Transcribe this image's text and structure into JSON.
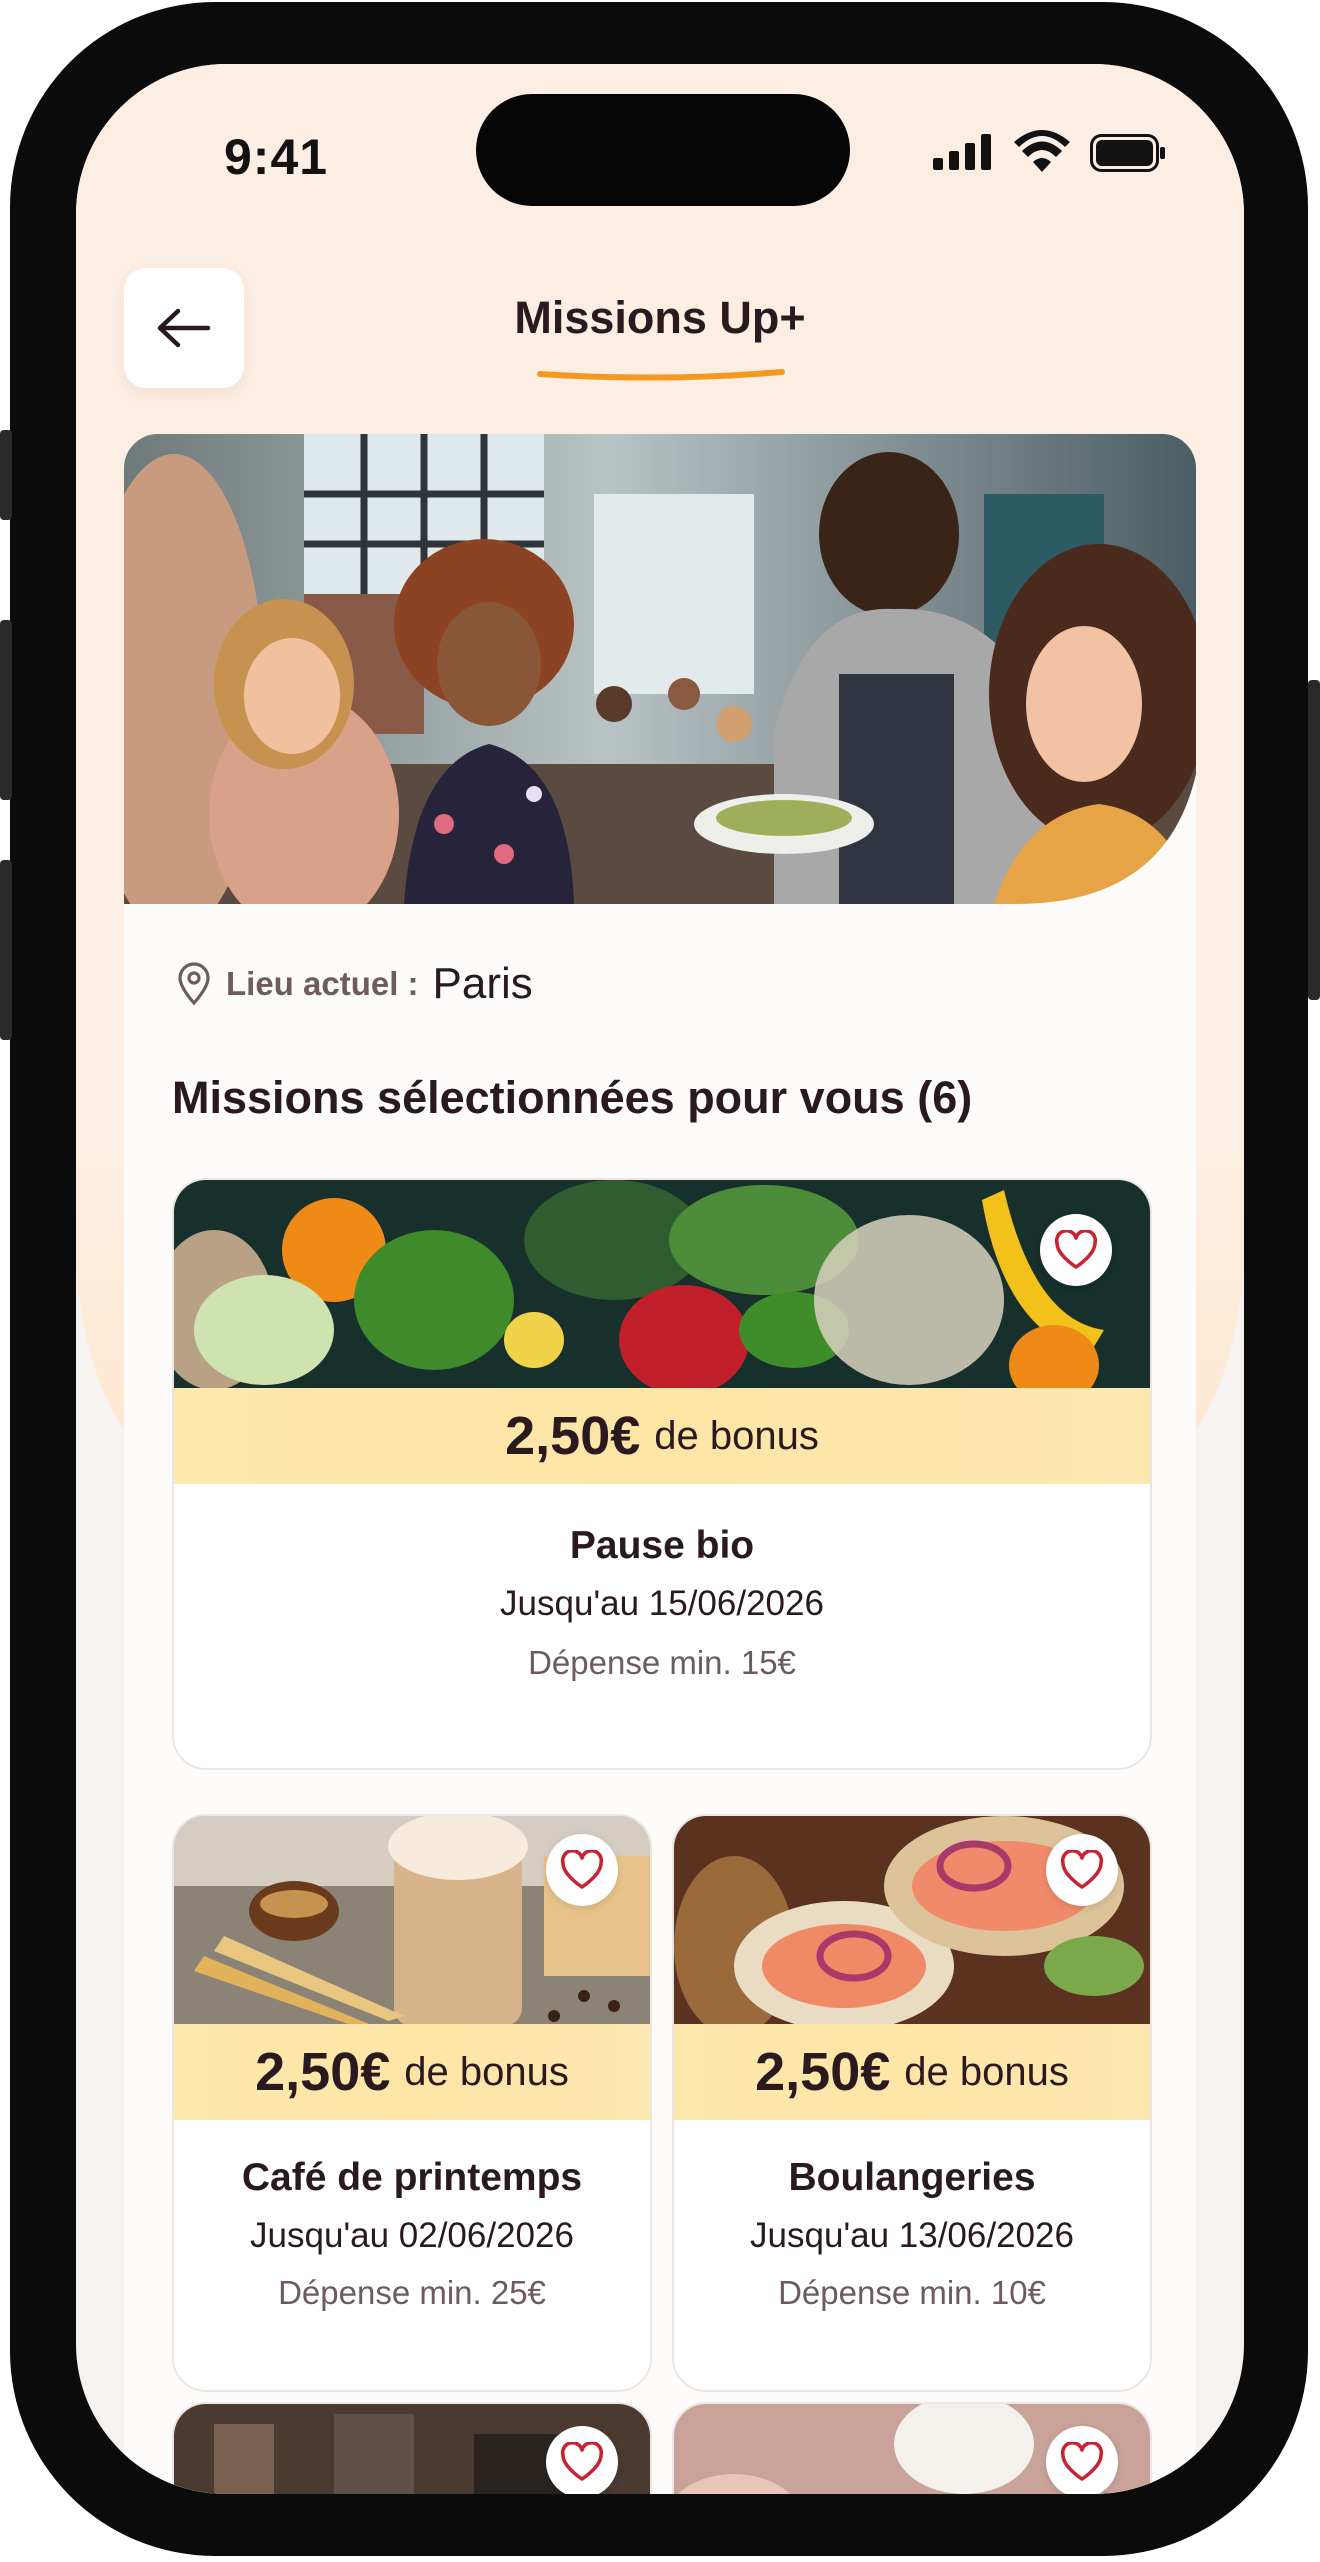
{
  "status_bar": {
    "time": "9:41"
  },
  "header": {
    "title": "Missions Up+",
    "back_icon": "arrow-left-icon"
  },
  "location": {
    "label": "Lieu actuel :",
    "value": "Paris",
    "icon": "map-pin-icon"
  },
  "section": {
    "title": "Missions sélectionnées pour vous (6)"
  },
  "missions": [
    {
      "bonus_amount": "2,50€",
      "bonus_text": "de bonus",
      "title": "Pause bio",
      "date": "Jusqu'au 15/06/2026",
      "min_spend": "Dépense min. 15€",
      "favorite": false
    },
    {
      "bonus_amount": "2,50€",
      "bonus_text": "de bonus",
      "title": "Café de printemps",
      "date": "Jusqu'au 02/06/2026",
      "min_spend": "Dépense min. 25€",
      "favorite": false
    },
    {
      "bonus_amount": "2,50€",
      "bonus_text": "de bonus",
      "title": "Boulangeries",
      "date": "Jusqu'au 13/06/2026",
      "min_spend": "Dépense min. 10€",
      "favorite": false
    }
  ],
  "colors": {
    "accent": "#f39a1e",
    "bonus_bar": "#fde6a8",
    "text": "#2a1a1f",
    "heart": "#c62433",
    "background": "#fdeee3"
  }
}
